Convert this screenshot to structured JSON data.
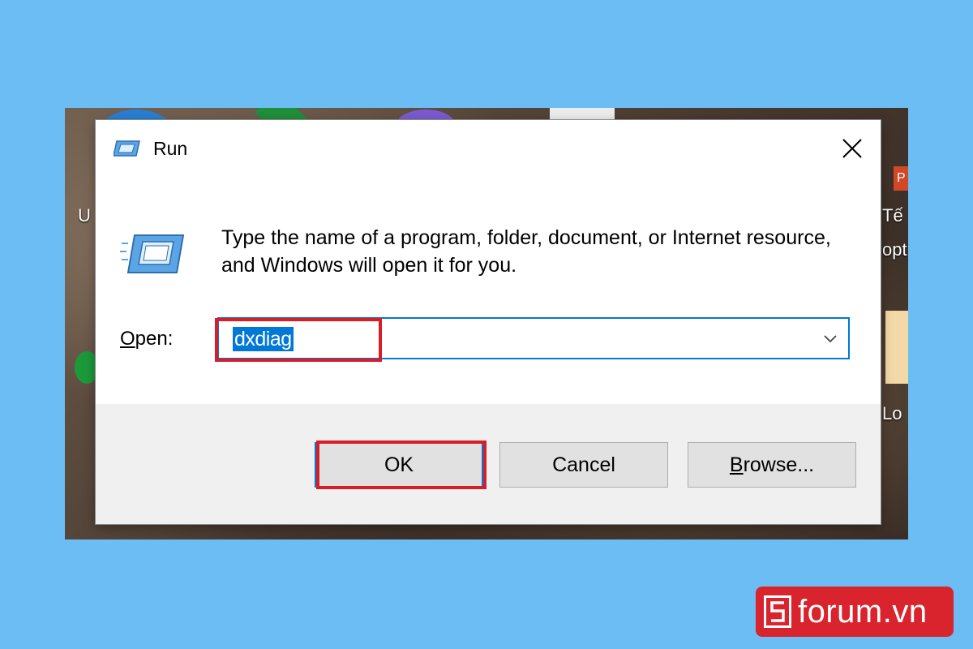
{
  "dialog": {
    "title": "Run",
    "description": "Type the name of a program, folder, document, or Internet resource, and Windows will open it for you.",
    "open_label_mnemonic": "O",
    "open_label_rest": "pen:",
    "open_value": "dxdiag",
    "buttons": {
      "ok": "OK",
      "cancel": "Cancel",
      "browse_mnemonic": "B",
      "browse_rest": "rowse..."
    }
  },
  "desktop_fragments": {
    "left": "U",
    "right_top": "Tế",
    "right_mid": "opt",
    "right_bottom": "Lo",
    "badge": "P"
  },
  "watermark": {
    "mark": "S",
    "text": "forum.vn"
  },
  "colors": {
    "background": "#6bbdf3",
    "accent_blue": "#0078d7",
    "highlight_red": "#d71e28",
    "brand_red": "#d9232d"
  }
}
